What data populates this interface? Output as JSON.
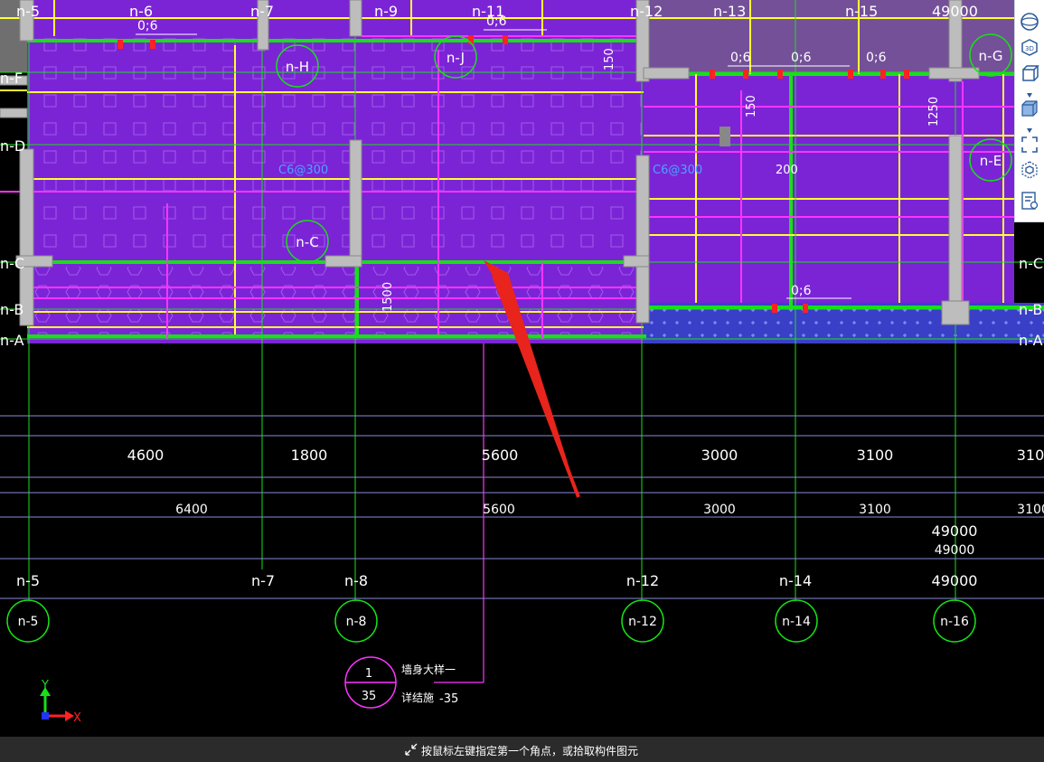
{
  "top_grid_labels": [
    "n-5",
    "n-6",
    "n-7",
    "n-9",
    "n-11",
    "n-12",
    "n-13",
    "n-15",
    "49000"
  ],
  "row_labels_left": [
    "n-F",
    "n-D",
    "n-C",
    "n-B",
    "n-A"
  ],
  "row_labels_right": [
    "n-C",
    "n-B",
    "n-A"
  ],
  "axis_bubbles_plan": [
    "n-H",
    "n-J",
    "n-G",
    "n-E",
    "n-C"
  ],
  "rebar_notes": [
    "0;6",
    "0;6",
    "0;6",
    "0;6",
    "0;6",
    "0;6"
  ],
  "plan_dimensions": [
    "150",
    "150",
    "1250",
    "200",
    "1500",
    "C6@300",
    "C6@300"
  ],
  "dim_row1": [
    "4600",
    "1800",
    "5600",
    "3000",
    "3100",
    "310"
  ],
  "dim_row2": [
    "6400",
    "5600",
    "3000",
    "3100",
    "3100"
  ],
  "total_dims": [
    "49000",
    "49000",
    "49000"
  ],
  "bottom_axis_text": [
    "n-5",
    "n-7",
    "n-8",
    "n-12",
    "n-14",
    "49000"
  ],
  "bottom_bubbles": [
    "n-5",
    "n-8",
    "n-12",
    "n-14",
    "n-16"
  ],
  "detail_callout": {
    "number": "1",
    "sheet": "35",
    "title": "墙身大样一",
    "ref": "详结施",
    "ref_sheet": "-35"
  },
  "coord_axes": {
    "x": "X",
    "y": "Y"
  },
  "toolbar_icons": [
    "sphere-view-icon",
    "3d-view-icon",
    "box-view-icon",
    "dropdown-icon",
    "solid-box-icon",
    "dropdown-icon",
    "fit-selection-icon",
    "cube-outline-icon",
    "layer-properties-icon"
  ],
  "status": {
    "message": "按鼠标左键指定第一个角点，或拾取构件图元"
  },
  "colors": {
    "background": "#000000",
    "slab_fill": "#7b24d6",
    "slab_blue": "#3a3fc8",
    "grid_green": "#17e017",
    "beam_yellow": "#ffff33",
    "rebar_magenta": "#ff33ff",
    "column_gray": "#bdbdbd",
    "arrow_red": "#e8241c",
    "statusbar": "#2b2b2b"
  }
}
